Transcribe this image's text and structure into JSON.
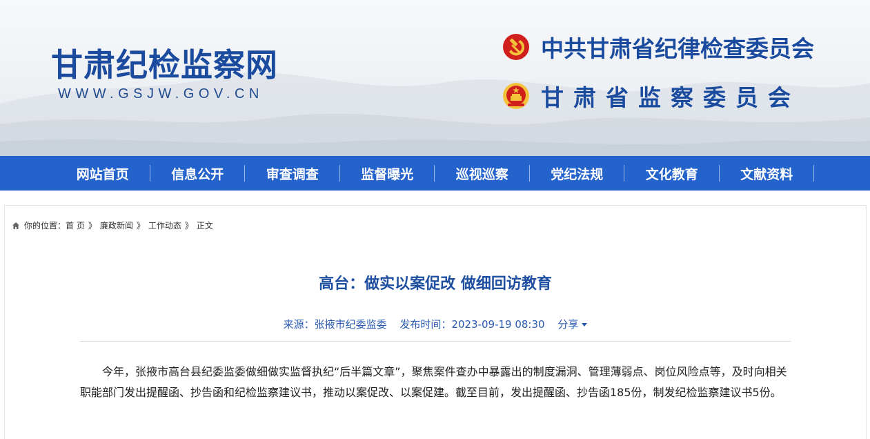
{
  "header": {
    "site_name": "甘肃纪检监察网",
    "site_url": "WWW.GSJW.GOV.CN",
    "org_party": "中共甘肃省纪律检查委员会",
    "org_supervision": "甘肃省监察委员会"
  },
  "nav": {
    "items": [
      "网站首页",
      "信息公开",
      "审查调查",
      "监督曝光",
      "巡视巡察",
      "党纪法规",
      "文化教育",
      "文献资料"
    ]
  },
  "breadcrumb": {
    "prefix": "你的位置：",
    "items": [
      "首 页",
      "廉政新闻",
      "工作动态",
      "正文"
    ],
    "separator": "》"
  },
  "article": {
    "title": "高台：做实以案促改 做细回访教育",
    "source": "来源：张掖市纪委监委",
    "published": "发布时间：2023-09-19 08:30",
    "share_label": "分享",
    "body": "今年，张掖市高台县纪委监委做细做实监督执纪“后半篇文章”，聚焦案件查办中暴露出的制度漏洞、管理薄弱点、岗位风险点等，及时向相关职能部门发出提醒函、抄告函和纪检监察建议书，推动以案促改、以案促建。截至目前，发出提醒函、抄告函185份，制发纪检监察建议书5份。"
  },
  "colors": {
    "brand_blue": "#1a4b9e",
    "nav_blue": "#2563cc",
    "title_blue": "#1f4fa0",
    "party_red": "#d0201b",
    "gold": "#f3c33b"
  },
  "icons": {
    "party": "hammer-sickle-icon",
    "national": "national-emblem-icon",
    "home": "home-icon"
  }
}
